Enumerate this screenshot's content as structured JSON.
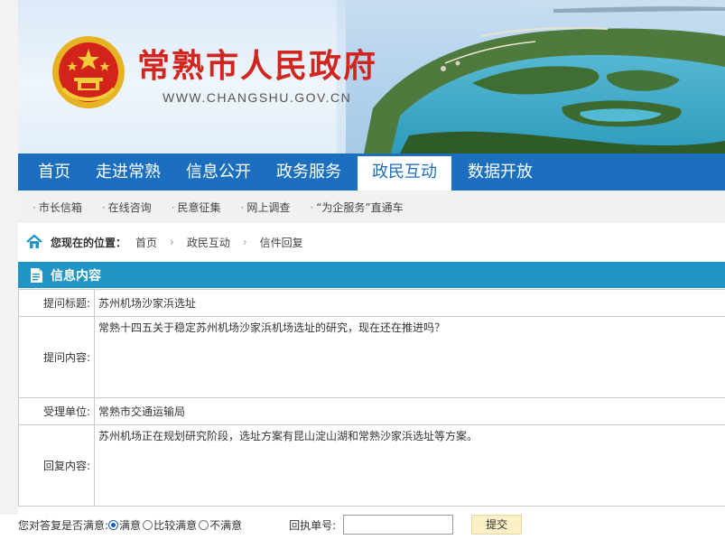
{
  "header": {
    "site_title": "常熟市人民政府",
    "site_url": "WWW.CHANGSHU.GOV.CN",
    "emblem_icon": "national-emblem-icon"
  },
  "nav": {
    "items": [
      {
        "label": "首页"
      },
      {
        "label": "走进常熟"
      },
      {
        "label": "信息公开"
      },
      {
        "label": "政务服务"
      },
      {
        "label": "政民互动"
      },
      {
        "label": "数据开放"
      }
    ],
    "active": "政民互动",
    "accent_color": "#1c6fbe"
  },
  "subnav": {
    "items": [
      {
        "label": "市长信箱"
      },
      {
        "label": "在线咨询"
      },
      {
        "label": "民意征集"
      },
      {
        "label": "网上调查"
      },
      {
        "label": "“为企服务”直通车"
      }
    ]
  },
  "breadcrumb": {
    "label": "您现在的位置：",
    "items": [
      "首页",
      "政民互动",
      "信件回复"
    ],
    "separator": "›"
  },
  "panel": {
    "title": "信息内容",
    "header_color": "#2196c4"
  },
  "letter": {
    "subject_label": "提问标题:",
    "subject": "苏州机场沙家浜选址",
    "question_label": "提问内容:",
    "question": "常熟十四五关于稳定苏州机场沙家浜机场选址的研究，现在还在推进吗？",
    "dept_label": "受理单位:",
    "dept": "常熟市交通运输局",
    "reply_label": "回复内容:",
    "reply": "苏州机场正在规划研究阶段，选址方案有昆山淀山湖和常熟沙家浜选址等方案。"
  },
  "feedback": {
    "prompt": "您对答复是否满意:",
    "options": [
      {
        "label": "满意",
        "checked": true
      },
      {
        "label": "比较满意",
        "checked": false
      },
      {
        "label": "不满意",
        "checked": false
      }
    ],
    "receipt_label": "回执单号:",
    "receipt_value": "",
    "submit_label": "提交"
  }
}
